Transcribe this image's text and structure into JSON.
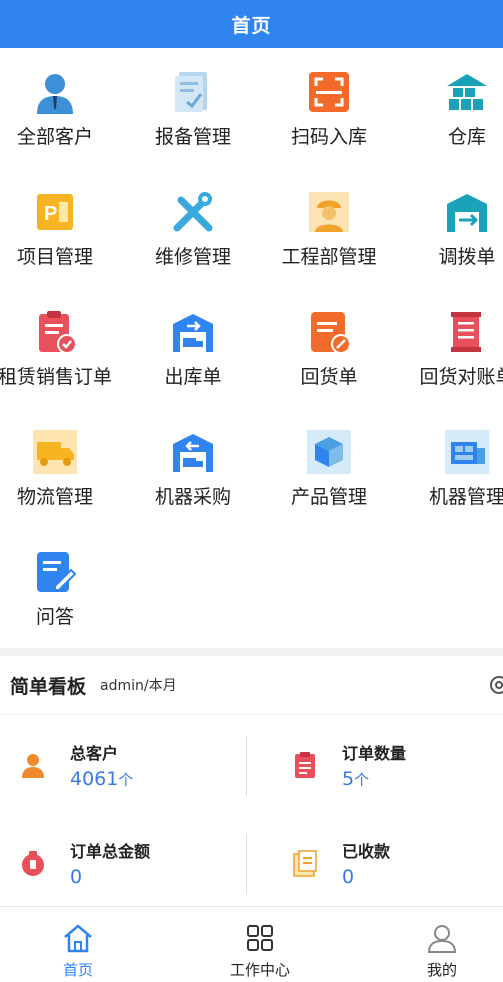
{
  "header": {
    "title": "首页"
  },
  "grid": [
    {
      "label": "全部客户",
      "icon": "person-icon"
    },
    {
      "label": "报备管理",
      "icon": "report-icon"
    },
    {
      "label": "扫码入库",
      "icon": "scan-icon"
    },
    {
      "label": "仓库",
      "icon": "warehouse-icon"
    },
    {
      "label": "项目管理",
      "icon": "project-icon"
    },
    {
      "label": "维修管理",
      "icon": "tools-icon"
    },
    {
      "label": "工程部管理",
      "icon": "engineer-icon"
    },
    {
      "label": "调拨单",
      "icon": "transfer-icon"
    },
    {
      "label": "租赁销售订单",
      "icon": "lease-order-icon"
    },
    {
      "label": "出库单",
      "icon": "outbound-icon"
    },
    {
      "label": "回货单",
      "icon": "return-icon"
    },
    {
      "label": "回货对账单",
      "icon": "reconciliation-icon"
    },
    {
      "label": "物流管理",
      "icon": "truck-icon"
    },
    {
      "label": "机器采购",
      "icon": "purchase-icon"
    },
    {
      "label": "产品管理",
      "icon": "product-icon"
    },
    {
      "label": "机器管理",
      "icon": "machine-icon"
    },
    {
      "label": "问答",
      "icon": "qa-icon"
    }
  ],
  "kanban": {
    "title": "简单看板",
    "subtitle": "admin/本月",
    "stats": [
      {
        "label": "总客户",
        "value": "4061",
        "unit": "个",
        "icon": "customer-icon"
      },
      {
        "label": "订单数量",
        "value": "5",
        "unit": "个",
        "icon": "order-count-icon"
      },
      {
        "label": "订单总金额",
        "value": "0",
        "unit": "",
        "icon": "money-bag-icon"
      },
      {
        "label": "已收款",
        "value": "0",
        "unit": "",
        "icon": "received-icon"
      }
    ]
  },
  "tabbar": {
    "items": [
      {
        "label": "首页",
        "icon": "home-icon",
        "active": true
      },
      {
        "label": "工作中心",
        "icon": "grid-icon",
        "active": false
      },
      {
        "label": "我的",
        "icon": "user-icon",
        "active": false
      }
    ]
  },
  "colors": {
    "primary": "#2f84f0",
    "value": "#3b7be0"
  }
}
